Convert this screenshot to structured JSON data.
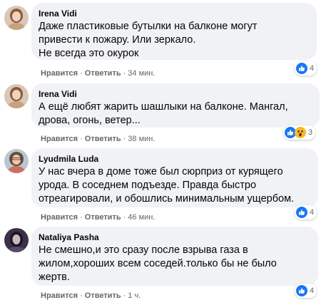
{
  "comments": [
    {
      "author": "Irena Vidi",
      "lines": [
        "Даже пластиковые бутылки на балконе могут",
        "привести к пожару. Или зеркало.",
        "Не всегда это окурок"
      ],
      "like": "Нравится",
      "reply": "Ответить",
      "time": "34 мин.",
      "reaction_icons": [
        "like-icon"
      ],
      "reaction_count": "4"
    },
    {
      "author": "Irena Vidi",
      "lines": [
        "А ещё любят жарить шашлыки на балконе. Мангал,",
        "дрова, огонь, ветер..."
      ],
      "like": "Нравится",
      "reply": "Ответить",
      "time": "38 мин.",
      "reaction_icons": [
        "like-icon",
        "wow-icon"
      ],
      "reaction_count": "3"
    },
    {
      "author": "Lyudmila Luda",
      "lines": [
        "У нас вчера в доме тоже был сюрприз от курящего",
        "урода. В соседнем подъезде. Правда быстро",
        "отреагировали, и обошлись минимальным ущербом."
      ],
      "like": "Нравится",
      "reply": "Ответить",
      "time": "46 мин.",
      "reaction_icons": [
        "like-icon"
      ],
      "reaction_count": "4"
    },
    {
      "author": "Nataliya Pasha",
      "lines": [
        "Не смешно,и это сразу после взрыва газа в",
        "жилом,хороших всем соседей.только бы не было",
        "жертв."
      ],
      "like": "Нравится",
      "reply": "Ответить",
      "time": "1 ч.",
      "reaction_icons": [
        "like-icon"
      ],
      "reaction_count": "4"
    }
  ],
  "colors": {
    "bubble": "#f0f2f5",
    "meta_text": "#65676b",
    "like_blue": "#1877f2",
    "wow_yellow": "#f7b928"
  }
}
